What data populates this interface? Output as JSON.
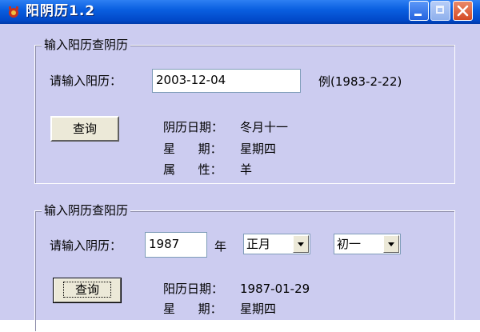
{
  "window": {
    "title": "阳阴历1.2"
  },
  "solar_to_lunar": {
    "group_title": "输入阳历查阴历",
    "input_label": "请输入阳历：",
    "input_value": "2003-12-04",
    "example": "例(1983-2-22)",
    "query_label": "查询",
    "results": {
      "date_label": "阴历日期：",
      "date_value": "冬月十一",
      "weekday_label": "星      期：",
      "weekday_value": "星期四",
      "zodiac_label": "属      性：",
      "zodiac_value": "羊"
    }
  },
  "lunar_to_solar": {
    "group_title": "输入阴历查阳历",
    "input_label": "请输入阴历：",
    "year_value": "1987",
    "year_unit": "年",
    "month_selected": "正月",
    "day_selected": "初一",
    "query_label": "查询",
    "results": {
      "date_label": "阳历日期：",
      "date_value": "1987-01-29",
      "weekday_label": "星      期：",
      "weekday_value": "星期四"
    }
  }
}
